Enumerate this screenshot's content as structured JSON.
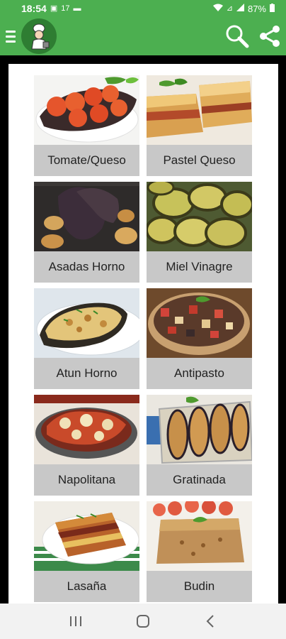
{
  "status_bar": {
    "time": "18:54",
    "notif_count": "17",
    "battery": "87%"
  },
  "app_bar": {
    "menu_icon": "hamburger-menu-icon",
    "logo_icon": "chef-logo-icon",
    "search_icon": "search-icon",
    "share_icon": "share-icon"
  },
  "recipes": [
    {
      "label": "Tomate/Queso"
    },
    {
      "label": "Pastel Queso"
    },
    {
      "label": "Asadas Horno"
    },
    {
      "label": "Miel Vinagre"
    },
    {
      "label": "Atun Horno"
    },
    {
      "label": "Antipasto"
    },
    {
      "label": "Napolitana"
    },
    {
      "label": "Gratinada"
    },
    {
      "label": "Lasaña"
    },
    {
      "label": "Budin"
    }
  ],
  "colors": {
    "accent": "#4caf50",
    "card_label_bg": "#c8c8c8"
  }
}
